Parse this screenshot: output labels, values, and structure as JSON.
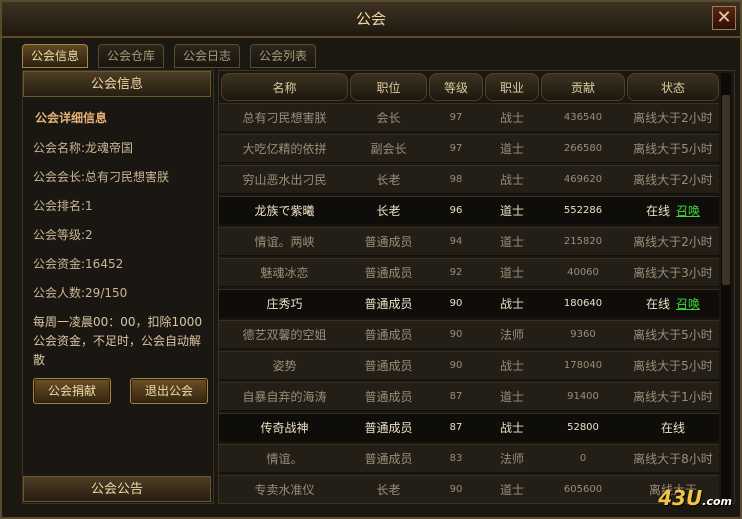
{
  "window": {
    "title": "公会",
    "close_glyph": "✕"
  },
  "tabs": [
    "公会信息",
    "公会仓库",
    "公会日志",
    "公会列表"
  ],
  "left": {
    "header": "公会信息",
    "detail_title": "公会详细信息",
    "lines": [
      "公会名称:龙魂帝国",
      "公会会长:总有刁民想害朕",
      "公会排名:1",
      "公会等级:2",
      "公会资金:16452",
      "公会人数:29/150"
    ],
    "notice": "每周一凌晨00：00，扣除1000公会资金，不足时，公会自动解散",
    "donate_button": "公会捐献",
    "leave_button": "退出公会",
    "announcement_header": "公会公告"
  },
  "table": {
    "columns": [
      "名称",
      "职位",
      "等级",
      "职业",
      "贡献",
      "状态"
    ],
    "summon_label": "召唤",
    "rows": [
      {
        "name": "总有刁民想害朕",
        "position": "会长",
        "level": "97",
        "job": "战士",
        "contribution": "436540",
        "status": "离线大于2小时",
        "online": false
      },
      {
        "name": "大吃亿精的依拼",
        "position": "副会长",
        "level": "97",
        "job": "道士",
        "contribution": "266580",
        "status": "离线大于5小时",
        "online": false
      },
      {
        "name": "穷山恶水出刁民",
        "position": "长老",
        "level": "98",
        "job": "战士",
        "contribution": "469620",
        "status": "离线大于2小时",
        "online": false
      },
      {
        "name": "龙族で紫曦",
        "position": "长老",
        "level": "96",
        "job": "道士",
        "contribution": "552286",
        "status": "在线",
        "online": true,
        "summon": true
      },
      {
        "name": "情谊。两峡",
        "position": "普通成员",
        "level": "94",
        "job": "道士",
        "contribution": "215820",
        "status": "离线大于2小时",
        "online": false
      },
      {
        "name": "魅魂冰恋",
        "position": "普通成员",
        "level": "92",
        "job": "道士",
        "contribution": "40060",
        "status": "离线大于3小时",
        "online": false
      },
      {
        "name": "庄秀巧",
        "position": "普通成员",
        "level": "90",
        "job": "战士",
        "contribution": "180640",
        "status": "在线",
        "online": true,
        "summon": true
      },
      {
        "name": "德艺双馨的空姐",
        "position": "普通成员",
        "level": "90",
        "job": "法师",
        "contribution": "9360",
        "status": "离线大于5小时",
        "online": false
      },
      {
        "name": "姿势",
        "position": "普通成员",
        "level": "90",
        "job": "战士",
        "contribution": "178040",
        "status": "离线大于5小时",
        "online": false
      },
      {
        "name": "自暴自弃的海涛",
        "position": "普通成员",
        "level": "87",
        "job": "道士",
        "contribution": "91400",
        "status": "离线大于1小时",
        "online": false
      },
      {
        "name": "传奇战神",
        "position": "普通成员",
        "level": "87",
        "job": "战士",
        "contribution": "52800",
        "status": "在线",
        "online": true,
        "summon": false
      },
      {
        "name": "情谊。",
        "position": "普通成员",
        "level": "83",
        "job": "法师",
        "contribution": "0",
        "status": "离线大于8小时",
        "online": false
      },
      {
        "name": "专卖水准仪",
        "position": "长老",
        "level": "90",
        "job": "道士",
        "contribution": "605600",
        "status": "离线大于",
        "online": false
      }
    ]
  },
  "watermark": {
    "brand": "43U",
    "suffix": ".com"
  }
}
